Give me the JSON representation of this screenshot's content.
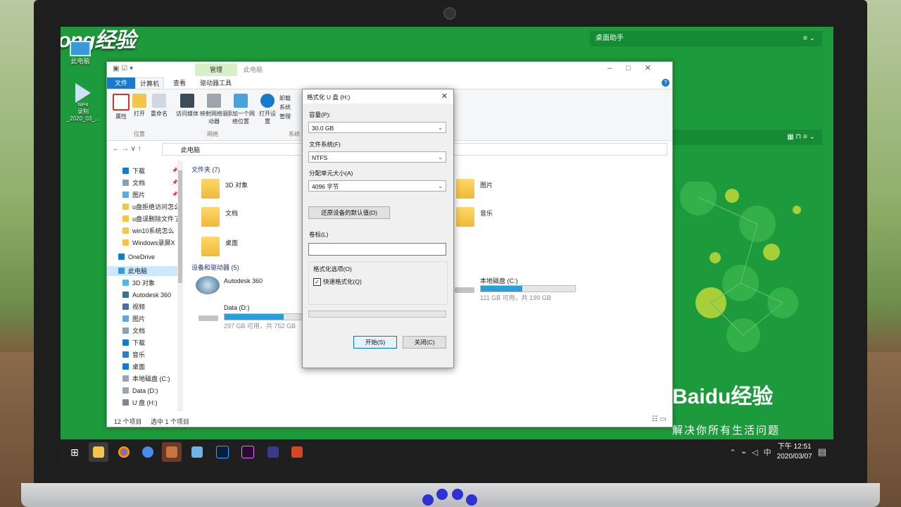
{
  "watermark": "秒dong经验",
  "desktop": {
    "icons": [
      {
        "label": "此电脑"
      },
      {
        "label": "录制\n_2020_03_...",
        "badge": "MP4"
      }
    ],
    "helper_title": "桌面助手",
    "baidu_logo": "Baidu经验",
    "baidu_slogan": "解决你所有生活问题"
  },
  "explorer": {
    "title": "此电脑",
    "contextual_tab": "管理",
    "tabs": [
      "文件",
      "计算机",
      "查看",
      "驱动器工具"
    ],
    "ribbon_groups": {
      "location": {
        "label": "位置",
        "buttons": [
          "属性",
          "打开",
          "重命名"
        ]
      },
      "network": {
        "label": "网络",
        "buttons": [
          "访问媒体",
          "映射网络驱动器",
          "添加一个网络位置"
        ]
      },
      "system": {
        "label": "系统",
        "buttons": [
          "打开设置"
        ],
        "side_items": [
          "卸载",
          "系统",
          "管理"
        ]
      }
    },
    "address": "此电脑",
    "nav_items": [
      {
        "label": "下载",
        "icon": "download-icon",
        "pinned": true
      },
      {
        "label": "文档",
        "icon": "document-icon",
        "pinned": true
      },
      {
        "label": "图片",
        "icon": "picture-icon",
        "pinned": true
      },
      {
        "label": "u盘拒绝访问怎么",
        "icon": "folder-icon"
      },
      {
        "label": "u盘误删除文件了",
        "icon": "folder-icon"
      },
      {
        "label": "win10系统怎么",
        "icon": "folder-icon"
      },
      {
        "label": "Windows录屏X",
        "icon": "folder-icon"
      },
      {
        "label": "OneDrive",
        "icon": "cloud-icon"
      },
      {
        "label": "此电脑",
        "icon": "computer-icon",
        "selected": true
      },
      {
        "label": "3D 对象",
        "icon": "cube-icon"
      },
      {
        "label": "Autodesk 360",
        "icon": "autodesk-icon"
      },
      {
        "label": "视频",
        "icon": "video-icon"
      },
      {
        "label": "图片",
        "icon": "picture-icon"
      },
      {
        "label": "文档",
        "icon": "document-icon"
      },
      {
        "label": "下载",
        "icon": "download-icon"
      },
      {
        "label": "音乐",
        "icon": "music-icon"
      },
      {
        "label": "桌面",
        "icon": "desktop-icon"
      },
      {
        "label": "本地磁盘 (C:)",
        "icon": "drive-icon"
      },
      {
        "label": "Data (D:)",
        "icon": "drive-icon"
      },
      {
        "label": "U 盘 (H:)",
        "icon": "usb-icon"
      }
    ],
    "folders_header": "文件夹 (7)",
    "folders": [
      "3D 对象",
      "文档",
      "桌面",
      "图片",
      "音乐"
    ],
    "devices_header": "设备和驱动器 (5)",
    "devices": [
      {
        "name": "Autodesk 360"
      },
      {
        "name": "Data (D:)",
        "free": "297 GB 可用，共 752 GB",
        "used_fraction": 0.6
      },
      {
        "name": "本地磁盘 (C:)",
        "free": "111 GB 可用，共 199 GB",
        "used_fraction": 0.44
      }
    ],
    "status_count": "12 个项目",
    "status_selected": "选中 1 个项目"
  },
  "dialog": {
    "title": "格式化 U 盘 (H:)",
    "capacity_label": "容量(P):",
    "capacity_value": "30.0 GB",
    "filesystem_label": "文件系统(F)",
    "filesystem_value": "NTFS",
    "alloc_label": "分配单元大小(A)",
    "alloc_value": "4096 字节",
    "restore_button": "还原设备的默认值(D)",
    "volume_label": "卷标(L)",
    "volume_value": "",
    "options_label": "格式化选项(O)",
    "quick_format_label": "快速格式化(Q)",
    "quick_format_checked": true,
    "progress": 0,
    "start_button": "开始(S)",
    "close_button": "关闭(C)"
  },
  "taskbar": {
    "clock_time": "下午 12:51",
    "clock_date": "2020/03/07",
    "ime": "中"
  },
  "colors": {
    "desktop_green": "#1d9a3c",
    "accent_blue": "#1979ca",
    "drive_fill": "#26a0da",
    "tab_contextual": "#d7f0c9"
  }
}
